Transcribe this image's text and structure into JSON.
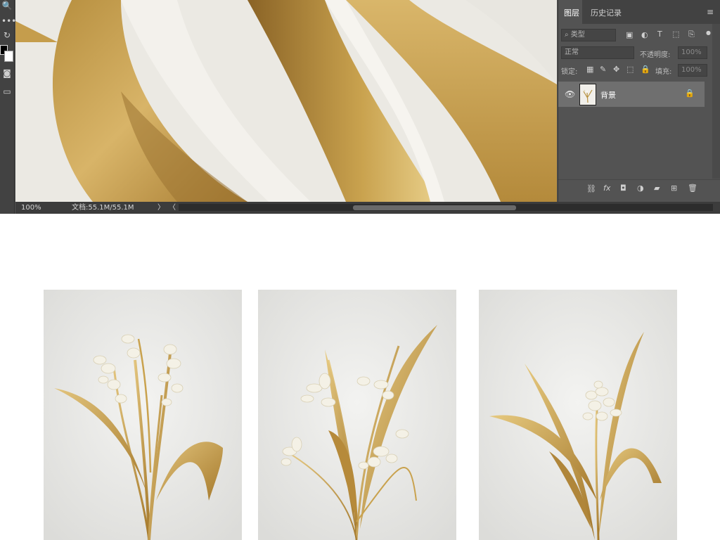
{
  "status_bar": {
    "zoom": "100%",
    "doc_info": "文档:55.1M/55.1M",
    "nav_arrow": "〉",
    "nav_arrow_2": "〈"
  },
  "layers_panel": {
    "tabs": [
      "图层",
      "历史记录"
    ],
    "filter": {
      "label": "类型"
    },
    "blend_mode": "正常",
    "opacity_label": "不透明度:",
    "opacity_value": "100%",
    "lock_label": "锁定:",
    "fill_label": "填充:",
    "fill_value": "100%",
    "layers": [
      {
        "name": "背景",
        "visible": true,
        "locked": true
      }
    ]
  },
  "colors": {
    "accent_gold": "#c9a24e",
    "canvas_bg": "#e9e7e1",
    "panel_bg": "#535353"
  },
  "gallery": {
    "cards": [
      "card-1",
      "card-2",
      "card-3"
    ]
  }
}
